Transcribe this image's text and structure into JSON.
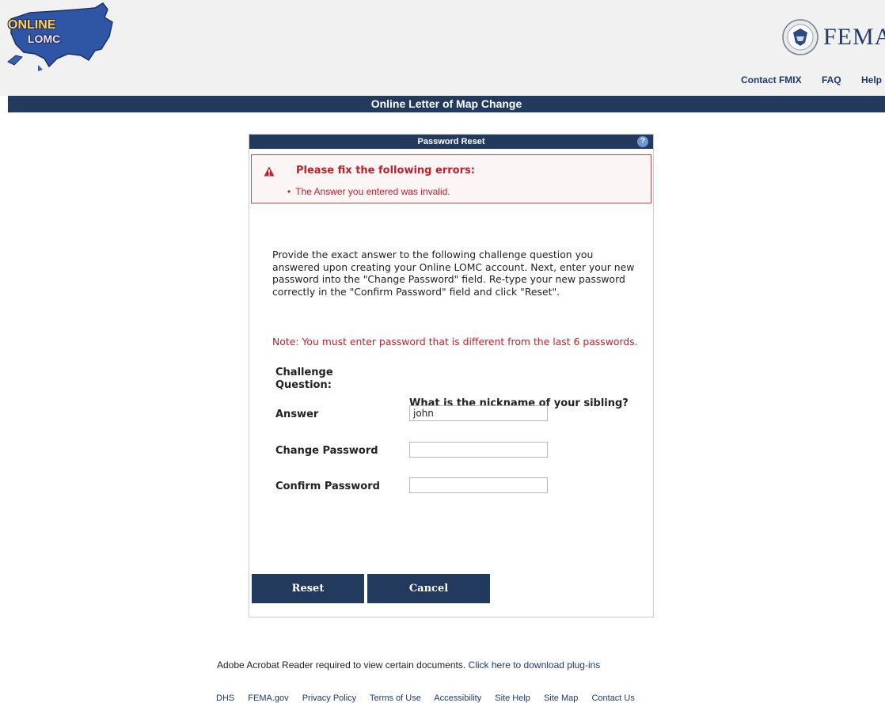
{
  "header": {
    "logo_line1": "ONLINE",
    "logo_line2": "LOMC",
    "agency": "FEMA",
    "links": [
      "Contact FMIX",
      "FAQ",
      "Help"
    ]
  },
  "banner": {
    "title": "Online Letter of Map Change"
  },
  "panel": {
    "title": "Password Reset",
    "help_icon": "?",
    "errors": {
      "title": "Please fix the following errors:",
      "items": [
        "The Answer you entered was invalid."
      ]
    },
    "instructions": "Provide the exact answer to the following challenge question you answered upon creating your Online LOMC account. Next, enter your new password into the \"Change Password\" field. Re-type your new password correctly in the \"Confirm Password\" field and click \"Reset\".",
    "note": "Note: You must enter password that is different from the last 6 passwords.",
    "form": {
      "challenge_label": "Challenge Question:",
      "challenge_question": "What is the nickname of your sibling?",
      "answer_label": "Answer",
      "answer_value": "john",
      "change_password_label": "Change Password",
      "change_password_value": "",
      "confirm_password_label": "Confirm Password",
      "confirm_password_value": ""
    },
    "buttons": {
      "reset": "Reset",
      "cancel": "Cancel"
    }
  },
  "footer": {
    "acrobat_text": "Adobe Acrobat Reader required to view certain documents.",
    "acrobat_link": "Click here to download plug-ins",
    "links": [
      "DHS",
      "FEMA.gov",
      "Privacy Policy",
      "Terms of Use",
      "Accessibility",
      "Site Help",
      "Site Map",
      "Contact Us"
    ]
  }
}
